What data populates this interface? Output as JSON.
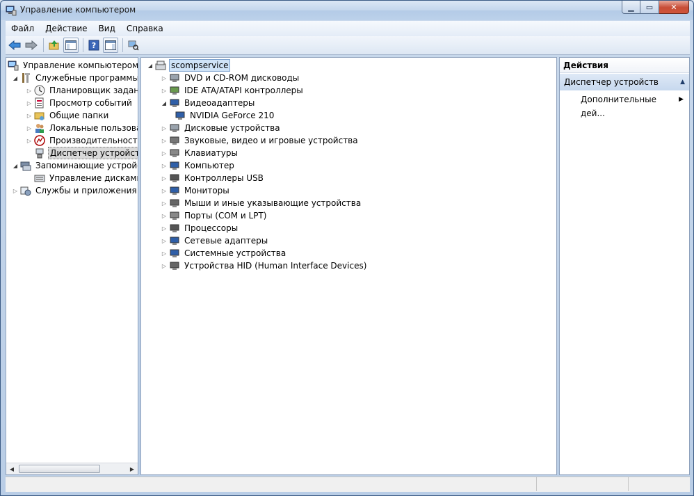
{
  "window": {
    "title": "Управление компьютером"
  },
  "menubar": [
    "Файл",
    "Действие",
    "Вид",
    "Справка"
  ],
  "toolbar": {
    "buttons": [
      "back-icon",
      "forward-icon",
      "up-folder-icon",
      "show-hide-console-tree-icon",
      "help-icon",
      "show-hide-action-pane-icon",
      "scan-hardware-icon"
    ]
  },
  "left_tree": {
    "root": "Управление компьютером (л",
    "system_tools": "Служебные программы",
    "task_scheduler": "Планировщик заданий",
    "event_viewer": "Просмотр событий",
    "shared_folders": "Общие папки",
    "local_users": "Локальные пользовате",
    "performance": "Производительность",
    "device_manager": "Диспетчер устройств",
    "storage": "Запоминающие устройст",
    "disk_management": "Управление дисками",
    "services_apps": "Службы и приложения"
  },
  "device_tree": {
    "computer_name": "scompservice",
    "categories": [
      "DVD и CD-ROM дисководы",
      "IDE ATA/ATAPI контроллеры",
      "Видеоадаптеры",
      "NVIDIA GeForce 210",
      "Дисковые устройства",
      "Звуковые, видео и игровые устройства",
      "Клавиатуры",
      "Компьютер",
      "Контроллеры USB",
      "Мониторы",
      "Мыши и иные указывающие устройства",
      "Порты (COM и LPT)",
      "Процессоры",
      "Сетевые адаптеры",
      "Системные устройства",
      "Устройства HID (Human Interface Devices)"
    ]
  },
  "actions": {
    "header": "Действия",
    "section": "Диспетчер устройств",
    "item": "Дополнительные дей..."
  }
}
